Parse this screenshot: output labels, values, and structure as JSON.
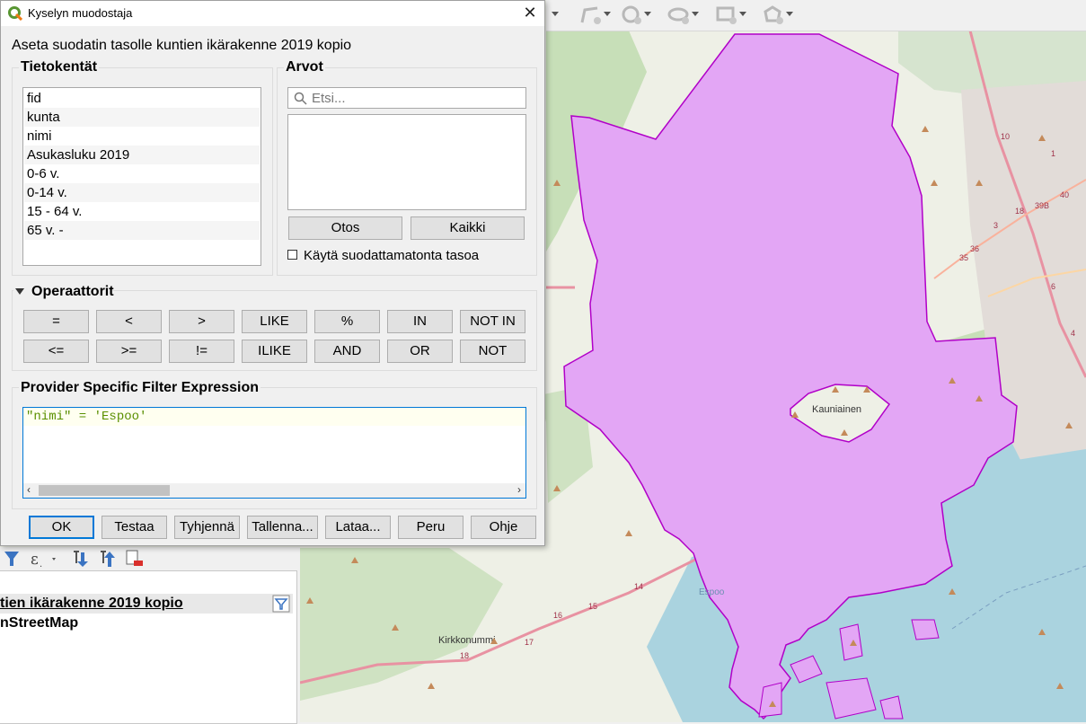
{
  "dialog": {
    "title": "Kyselyn muodostaja",
    "close_glyph": "✕",
    "subtitle": "Aseta suodatin tasolle kuntien ikärakenne 2019 kopio",
    "fields_group": {
      "title": "Tietokentät",
      "items": [
        "fid",
        "kunta",
        "nimi",
        "Asukasluku 2019",
        "0-6 v.",
        "0-14 v.",
        "15 - 64 v.",
        "65 v. -"
      ]
    },
    "values_group": {
      "title": "Arvot",
      "search_placeholder": "Etsi...",
      "sample_button": "Otos",
      "all_button": "Kaikki",
      "unfiltered_checkbox_label": "Käytä suodattamatonta tasoa",
      "unfiltered_checked": false
    },
    "operators_group": {
      "title": "Operaattorit",
      "row1": [
        "=",
        "<",
        ">",
        "LIKE",
        "%",
        "IN",
        "NOT IN"
      ],
      "row2": [
        "<=",
        ">=",
        "!=",
        "ILIKE",
        "AND",
        "OR",
        "NOT"
      ]
    },
    "expression_group": {
      "title": "Provider Specific Filter Expression",
      "expression": "\"nimi\" = 'Espoo'"
    },
    "buttons": {
      "ok": "OK",
      "test": "Testaa",
      "clear": "Tyhjennä",
      "save": "Tallenna...",
      "load": "Lataa...",
      "cancel": "Peru",
      "help": "Ohje"
    }
  },
  "layers_panel": {
    "layers": [
      "tien ikärakenne 2019 kopio",
      "nStreetMap"
    ]
  },
  "map": {
    "place_labels": [
      "Kauniainen",
      "Kirkkonummi",
      "Espoo"
    ],
    "road_numbers": [
      "14",
      "15",
      "16",
      "17",
      "18",
      "10",
      "1",
      "39B",
      "40",
      "18",
      "3",
      "36",
      "35",
      "6",
      "4"
    ],
    "polygon_color": "#e3a6f5",
    "polygon_stroke": "#b100c8"
  },
  "colors": {
    "accent": "#0078d7",
    "water": "#aad3df",
    "land": "#f2efe9",
    "forest": "#add19e"
  }
}
